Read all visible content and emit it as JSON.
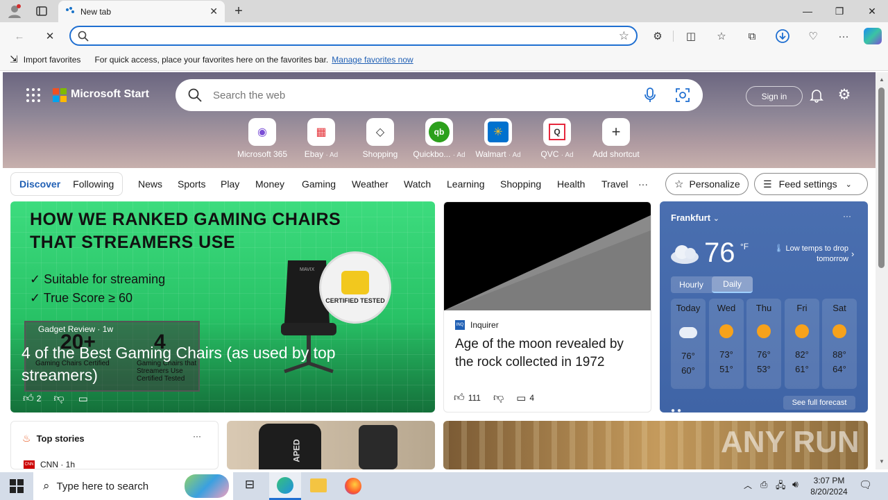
{
  "browser": {
    "tab_title": "New tab",
    "address_placeholder": "",
    "favorites_bar": {
      "import_label": "Import favorites",
      "hint": "For quick access, place your favorites here on the favorites bar.",
      "manage_link": "Manage favorites now"
    }
  },
  "header": {
    "brand": "Microsoft Start",
    "search_placeholder": "Search the web",
    "signin": "Sign in"
  },
  "shortcuts": [
    {
      "label": "Microsoft 365",
      "ad": "",
      "icon": "m365-icon",
      "color": "#7b4fd6",
      "glyph": "◉"
    },
    {
      "label": "Ebay",
      "ad": "· Ad",
      "icon": "ebay-bag-icon",
      "color": "#e53238",
      "glyph": "▦"
    },
    {
      "label": "Shopping",
      "ad": "",
      "icon": "tag-icon",
      "color": "#333333",
      "glyph": "◇"
    },
    {
      "label": "Quickbo...",
      "ad": "· Ad",
      "icon": "quickbooks-icon",
      "color": "#2ca01c",
      "glyph": "qb"
    },
    {
      "label": "Walmart",
      "ad": "· Ad",
      "icon": "walmart-icon",
      "color": "#0071ce",
      "glyph": "✳"
    },
    {
      "label": "QVC",
      "ad": "· Ad",
      "icon": "qvc-icon",
      "color": "#e6273c",
      "glyph": "Q"
    },
    {
      "label": "Add shortcut",
      "ad": "",
      "icon": "plus-icon",
      "color": "#333333",
      "glyph": "+"
    }
  ],
  "nav": {
    "discover": "Discover",
    "following": "Following",
    "items": [
      "News",
      "Sports",
      "Play",
      "Money",
      "Gaming",
      "Weather",
      "Watch",
      "Learning",
      "Shopping",
      "Health",
      "Travel"
    ],
    "more": "···",
    "personalize": "Personalize",
    "feed_settings": "Feed settings"
  },
  "game_card": {
    "headline_art": "HOW WE RANKED GAMING CHAIRS THAT STREAMERS USE",
    "check1": "Suitable for streaming",
    "check2": "True Score ≥ 60",
    "stat1_num": "20+",
    "stat1_text": "Gaming Chairs Certified",
    "stat2_num": "4",
    "stat2_text": "Gaming Chairs that Streamers Use Certified Tested",
    "badge": "CERTIFIED TESTED",
    "source": "Gadget Review · 1w",
    "title": "4 of the Best Gaming Chairs (as used by top streamers)",
    "likes": "2"
  },
  "moon_card": {
    "source": "Inquirer",
    "title": "Age of the moon revealed by the rock collected in 1972",
    "likes": "111",
    "comments": "4"
  },
  "weather": {
    "city": "Frankfurt",
    "temp": "76",
    "unit": "°F",
    "alert": "Low temps to drop tomorrow",
    "tab_hourly": "Hourly",
    "tab_daily": "Daily",
    "days": [
      {
        "name": "Today",
        "hi": "76°",
        "lo": "60°",
        "icon": "partly-cloudy-icon"
      },
      {
        "name": "Wed",
        "hi": "73°",
        "lo": "51°",
        "icon": "partly-sunny-icon"
      },
      {
        "name": "Thu",
        "hi": "76°",
        "lo": "53°",
        "icon": "partly-sunny-icon"
      },
      {
        "name": "Fri",
        "hi": "82°",
        "lo": "61°",
        "icon": "partly-sunny-icon"
      },
      {
        "name": "Sat",
        "hi": "88°",
        "lo": "64°",
        "icon": "sunny-icon"
      }
    ],
    "see_forecast": "See full forecast"
  },
  "top_stories": {
    "title": "Top stories",
    "source": "CNN · 1h"
  },
  "scooter_art": "APED",
  "watermark": "ANY RUN",
  "taskbar": {
    "search_placeholder": "Type here to search",
    "time": "3:07 PM",
    "date": "8/20/2024"
  }
}
